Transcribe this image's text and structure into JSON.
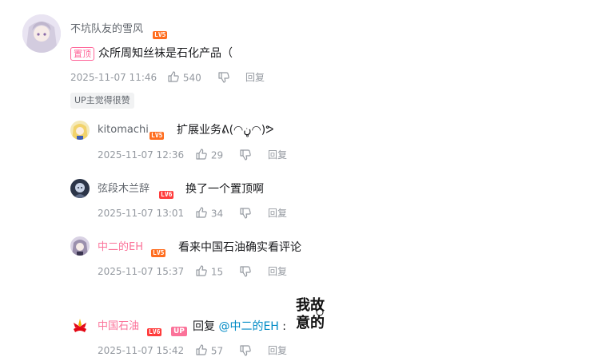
{
  "main_comment": {
    "username": "不坑队友的雪风",
    "level": "LV5",
    "pinned_label": "置顶",
    "content": "众所周知丝袜是石化产品（",
    "time": "2025-11-07 11:46",
    "likes": "540",
    "reply_label": "回复",
    "up_liked": "UP主觉得很赞"
  },
  "replies": [
    {
      "username": "kitomachi",
      "level": "LV5",
      "content": "扩展业务ᕕ(◠ڼ◠)ᕗ",
      "time": "2025-11-07 12:36",
      "likes": "29",
      "reply_label": "回复"
    },
    {
      "username": "弦段木兰辞",
      "level": "LV6",
      "content": "换了一个置顶啊",
      "time": "2025-11-07 13:01",
      "likes": "34",
      "reply_label": "回复"
    },
    {
      "username": "中二的EH",
      "level": "LV5",
      "content": "看来中国石油确实看评论",
      "time": "2025-11-07 15:37",
      "likes": "15",
      "reply_label": "回复"
    },
    {
      "username": "中国石油",
      "level": "LV6",
      "up_badge": "UP",
      "reply_prefix": "回复",
      "mention": "@中二的EH",
      "colon": ":",
      "sticker_text": "我故意的",
      "time": "2025-11-07 15:42",
      "likes": "57",
      "reply_label": "回复"
    }
  ],
  "colors": {
    "vip_name": "#fb7299",
    "normal_name": "#61666d",
    "meta_gray": "#9499a0",
    "link_blue": "#008ac5"
  }
}
